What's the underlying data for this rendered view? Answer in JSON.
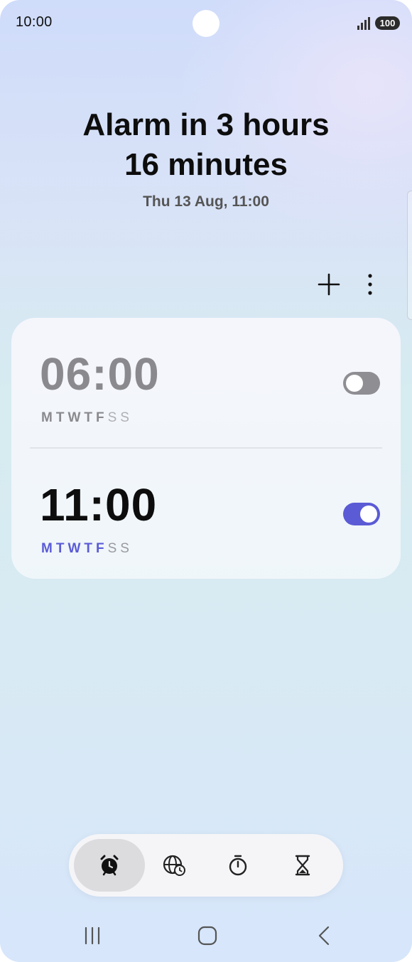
{
  "status_bar": {
    "time": "10:00",
    "battery": "100"
  },
  "header": {
    "title_line1": "Alarm in 3 hours",
    "title_line2": "16 minutes",
    "subtitle": "Thu 13 Aug, 11:00"
  },
  "toolbar": {
    "add_icon": "plus-icon",
    "more_icon": "more-vertical-icon"
  },
  "alarms": [
    {
      "time": "06:00",
      "enabled": false,
      "days": [
        {
          "label": "M",
          "active": true
        },
        {
          "label": "T",
          "active": true
        },
        {
          "label": "W",
          "active": true
        },
        {
          "label": "T",
          "active": true
        },
        {
          "label": "F",
          "active": true
        },
        {
          "label": "S",
          "active": false
        },
        {
          "label": "S",
          "active": false
        }
      ]
    },
    {
      "time": "11:00",
      "enabled": true,
      "days": [
        {
          "label": "M",
          "active": true
        },
        {
          "label": "T",
          "active": true
        },
        {
          "label": "W",
          "active": true
        },
        {
          "label": "T",
          "active": true
        },
        {
          "label": "F",
          "active": true
        },
        {
          "label": "S",
          "active": false
        },
        {
          "label": "S",
          "active": false
        }
      ]
    }
  ],
  "bottom_nav": [
    {
      "icon": "alarm-clock-icon",
      "active": true
    },
    {
      "icon": "world-clock-icon",
      "active": false
    },
    {
      "icon": "stopwatch-icon",
      "active": false
    },
    {
      "icon": "timer-hourglass-icon",
      "active": false
    }
  ],
  "colors": {
    "accent": "#5b5bd6",
    "toggle_off": "#8e8e93",
    "disabled_text": "#8a8a8e",
    "inactive_day": "#a6a6aa"
  }
}
